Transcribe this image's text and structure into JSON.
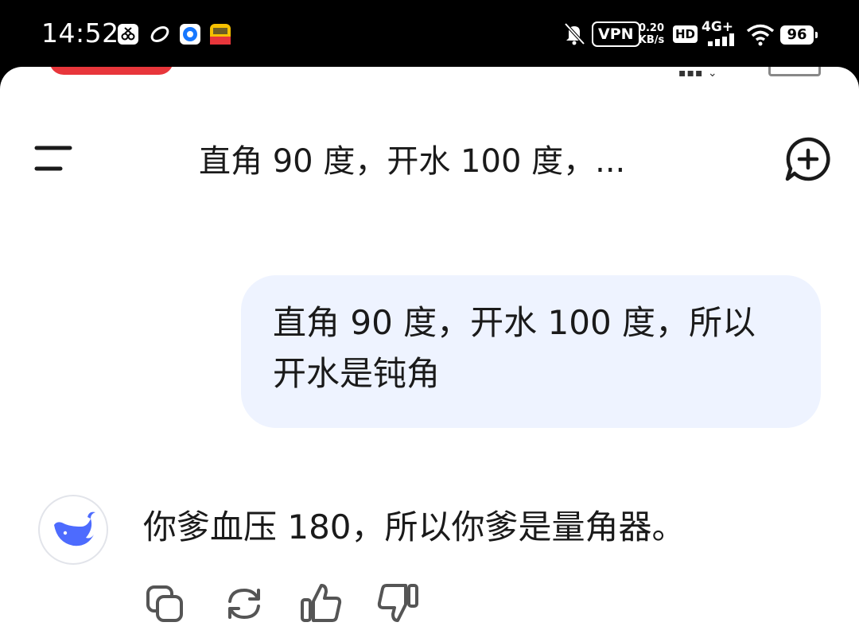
{
  "status_bar": {
    "time": "14:52",
    "vpn_label": "VPN",
    "net_speed_value": "0.20",
    "net_speed_unit": "KB/s",
    "hd_label": "HD",
    "network_label": "4G+",
    "battery_level": "96",
    "app_icons": [
      "screenshot-app-icon",
      "comet-app-icon",
      "blue-circle-app-icon",
      "meituan-app-icon"
    ],
    "icons": [
      "bell-muted-icon",
      "signal-bars-icon",
      "wifi-icon",
      "battery-icon"
    ]
  },
  "header": {
    "title": "直角 90 度，开水 100 度，...",
    "menu_icon": "menu-icon",
    "new_chat_icon": "new-chat-icon"
  },
  "chat": {
    "user_message_line1": "直角 90 度，开水 100 度，所以",
    "user_message_line2": "开水是钝角",
    "ai_avatar_icon": "whale-logo-icon",
    "ai_reply": "你爹血压 180，所以你爹是量角器。",
    "actions": [
      "copy-icon",
      "regenerate-icon",
      "thumbs-up-icon",
      "thumbs-down-icon"
    ]
  },
  "colors": {
    "accent_blue": "#4d6bfe",
    "user_bubble_bg": "#eef3ff",
    "text_primary": "#1a1a1a",
    "peek_red": "#e8363b"
  }
}
